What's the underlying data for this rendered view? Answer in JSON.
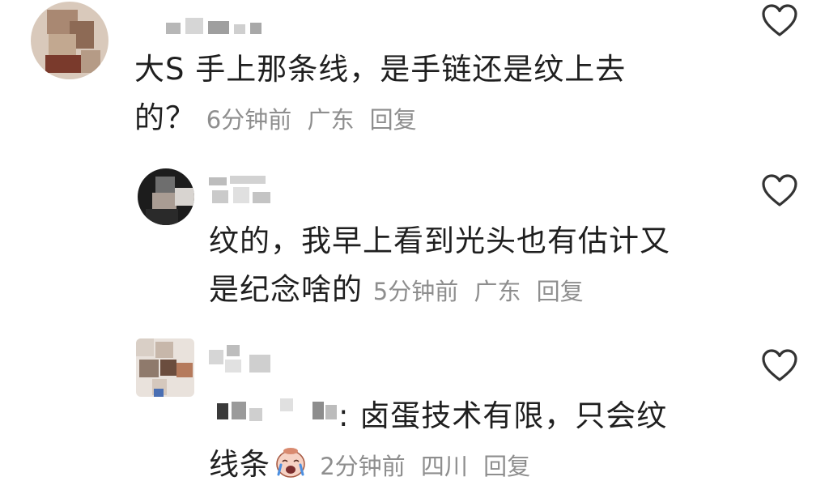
{
  "comments": [
    {
      "text_line1": "大S 手上那条线，是手链还是纹上去",
      "text_line2": "的？",
      "time": "6分钟前",
      "location": "广东",
      "reply": "回复",
      "liked": false
    },
    {
      "text_line1": "纹的，我早上看到光头也有估计又",
      "text_line2": "是纪念啥的",
      "time": "5分钟前",
      "location": "广东",
      "reply": "回复",
      "liked": false
    },
    {
      "text_line1_rest": ": 卤蛋技术有限，只会纹",
      "text_line2": "线条",
      "emoji_icon": "crying-laughing-face-sticker",
      "time": "2分钟前",
      "location": "四川",
      "reply": "回复",
      "liked": false
    }
  ],
  "icons": {
    "like": "heart-outline-icon"
  },
  "colors": {
    "text": "#1f1f1f",
    "meta": "#8e8e8e",
    "heart_stroke": "#333333"
  }
}
